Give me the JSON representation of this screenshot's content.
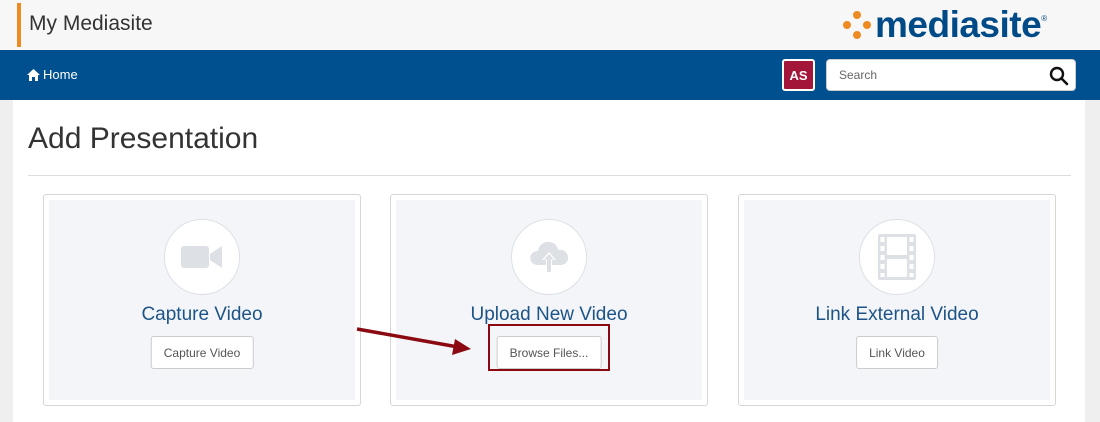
{
  "header": {
    "title": "My Mediasite",
    "logo_text": "mediasite",
    "logo_tm": "®",
    "accent_color": "#ee8a22",
    "brand_color": "#004b87"
  },
  "nav": {
    "home_label": "Home",
    "home_icon": "home-icon",
    "avatar_initials": "AS",
    "avatar_color": "#a3163a",
    "search_placeholder": "Search",
    "search_icon": "search-icon",
    "bar_color": "#00508f"
  },
  "main": {
    "page_title": "Add Presentation",
    "cards": [
      {
        "title": "Capture Video",
        "button_label": "Capture Video",
        "icon": "video-camera-icon"
      },
      {
        "title": "Upload New Video",
        "button_label": "Browse Files...",
        "icon": "cloud-upload-icon"
      },
      {
        "title": "Link External Video",
        "button_label": "Link Video",
        "icon": "film-strip-icon"
      }
    ]
  },
  "annotation": {
    "color": "#8b0a12",
    "target": "Browse Files..."
  }
}
